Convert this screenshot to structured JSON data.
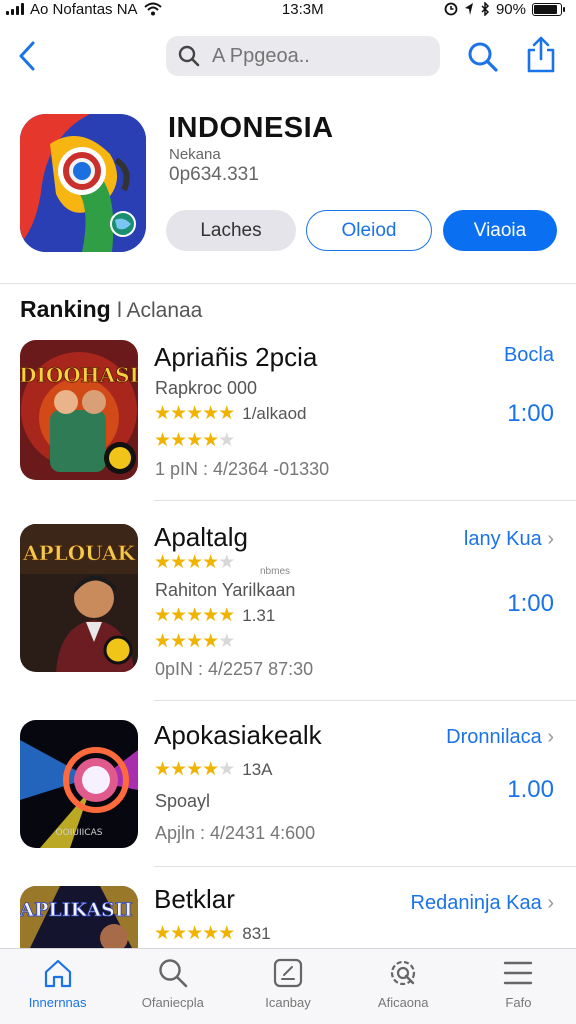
{
  "status_bar": {
    "carrier": "Ao Nofantas NA",
    "time": "13:3M",
    "battery_level": 90,
    "battery_text": "90%"
  },
  "nav": {
    "back_label": "",
    "search_placeholder": "A Ppgeoa.."
  },
  "app": {
    "title": "INDONESIA",
    "subtitle": "Nekana",
    "meta": "0p634.331",
    "button_gray": "Laches",
    "button_outline": "Oleiod",
    "button_primary": "Viaoia"
  },
  "section": {
    "title": "Ranking",
    "subtitle": "l Aclanaa"
  },
  "rows": [
    {
      "thumb_text": "DIOOHASI",
      "name": "Apriañis 2pcia",
      "subtitle": "Rapkroc 000",
      "rating1": 5,
      "rating1_label": "1/alkaod",
      "rating2": 4.5,
      "rating2_label": "",
      "meta": "1 pIN : 4/2364   -01330",
      "link": "Bocla",
      "price": "1:00"
    },
    {
      "thumb_text": "APLOUAK",
      "name": "Apaltalg",
      "rating1": 4.5,
      "rating1_label": "",
      "note": "nbmes",
      "subtitle": "Rahiton Yarilkaan",
      "rating2": 5,
      "rating2_label": "1.31",
      "rating3": 4.5,
      "rating3_label": "",
      "meta": "0pIN : 4/2257   87:30",
      "link": "lany Kua",
      "price": "1:00"
    },
    {
      "thumb_text": "OOIUIICAS",
      "name": "Apokasiakealk",
      "rating1": 4,
      "rating1_label": "13A",
      "subtitle": "Spoayl",
      "meta": "Apjln : 4/2431   4:600",
      "link": "Dronnilaca",
      "price": "1.00"
    },
    {
      "thumb_text": "APLIKASII",
      "name": "Betklar",
      "rating1": 5,
      "rating1_label": "831",
      "link": "Redaninja Kaa"
    }
  ],
  "tabs": [
    {
      "label": "Innernnas",
      "icon": "home-icon",
      "active": true
    },
    {
      "label": "Ofaniecpla",
      "icon": "search-icon",
      "active": false
    },
    {
      "label": "Icanbay",
      "icon": "edit-icon",
      "active": false
    },
    {
      "label": "Aficaona",
      "icon": "gear-icon",
      "active": false
    },
    {
      "label": "Fafo",
      "icon": "menu-icon",
      "active": false
    }
  ],
  "colors": {
    "accent": "#1a73e8",
    "primary_button": "#0a6ff0",
    "star": "#f0b400"
  }
}
